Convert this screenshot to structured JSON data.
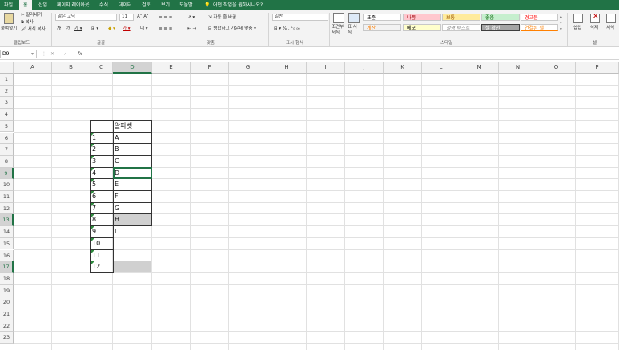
{
  "tabs": [
    "파일",
    "홈",
    "삽입",
    "페이지 레이아웃",
    "수식",
    "데이터",
    "검토",
    "보기",
    "도움말",
    "어떤 작업을 원하시나요?"
  ],
  "ribbon": {
    "clipboard": {
      "paste": "붙여넣기",
      "cut": "잘라내기",
      "copy": "복사",
      "format_painter": "서식 복사",
      "label": "클립보드"
    },
    "font": {
      "name": "맑은 고딕",
      "size": "11",
      "label": "글꼴"
    },
    "align": {
      "wrap": "자동 줄 바꿈",
      "merge": "병합하고 가운데 맞춤",
      "label": "맞춤"
    },
    "number": {
      "format": "일반",
      "label": "표시 형식"
    },
    "styles_buttons": {
      "conditional": "조건부 서식",
      "table": "표 서식"
    },
    "styles": [
      "표준",
      "나쁨",
      "보통",
      "좋음",
      "경고문",
      "계산",
      "메모",
      "설명 텍스트",
      "셀 확인",
      "연결된 셀"
    ],
    "styles_label": "스타일",
    "cells": {
      "insert": "삽입",
      "delete": "삭제",
      "format": "서식",
      "label": "셀"
    }
  },
  "formula_bar": {
    "name_box": "D9",
    "fx": "fx",
    "value": ""
  },
  "columns": [
    "A",
    "B",
    "C",
    "D",
    "E",
    "F",
    "G",
    "H",
    "I",
    "J",
    "K",
    "L",
    "M",
    "N",
    "O",
    "P"
  ],
  "rows": [
    "1",
    "2",
    "3",
    "4",
    "5",
    "6",
    "7",
    "8",
    "9",
    "10",
    "11",
    "12",
    "13",
    "14",
    "15",
    "16",
    "17",
    "18",
    "19",
    "20",
    "21",
    "22",
    "23"
  ],
  "table": {
    "header": "알파벳",
    "c_values": [
      "1",
      "2",
      "3",
      "4",
      "5",
      "6",
      "7",
      "8",
      "9",
      "10",
      "11",
      "12"
    ],
    "d_values": [
      "A",
      "B",
      "C",
      "D",
      "E",
      "F",
      "G",
      "H",
      "I"
    ]
  }
}
